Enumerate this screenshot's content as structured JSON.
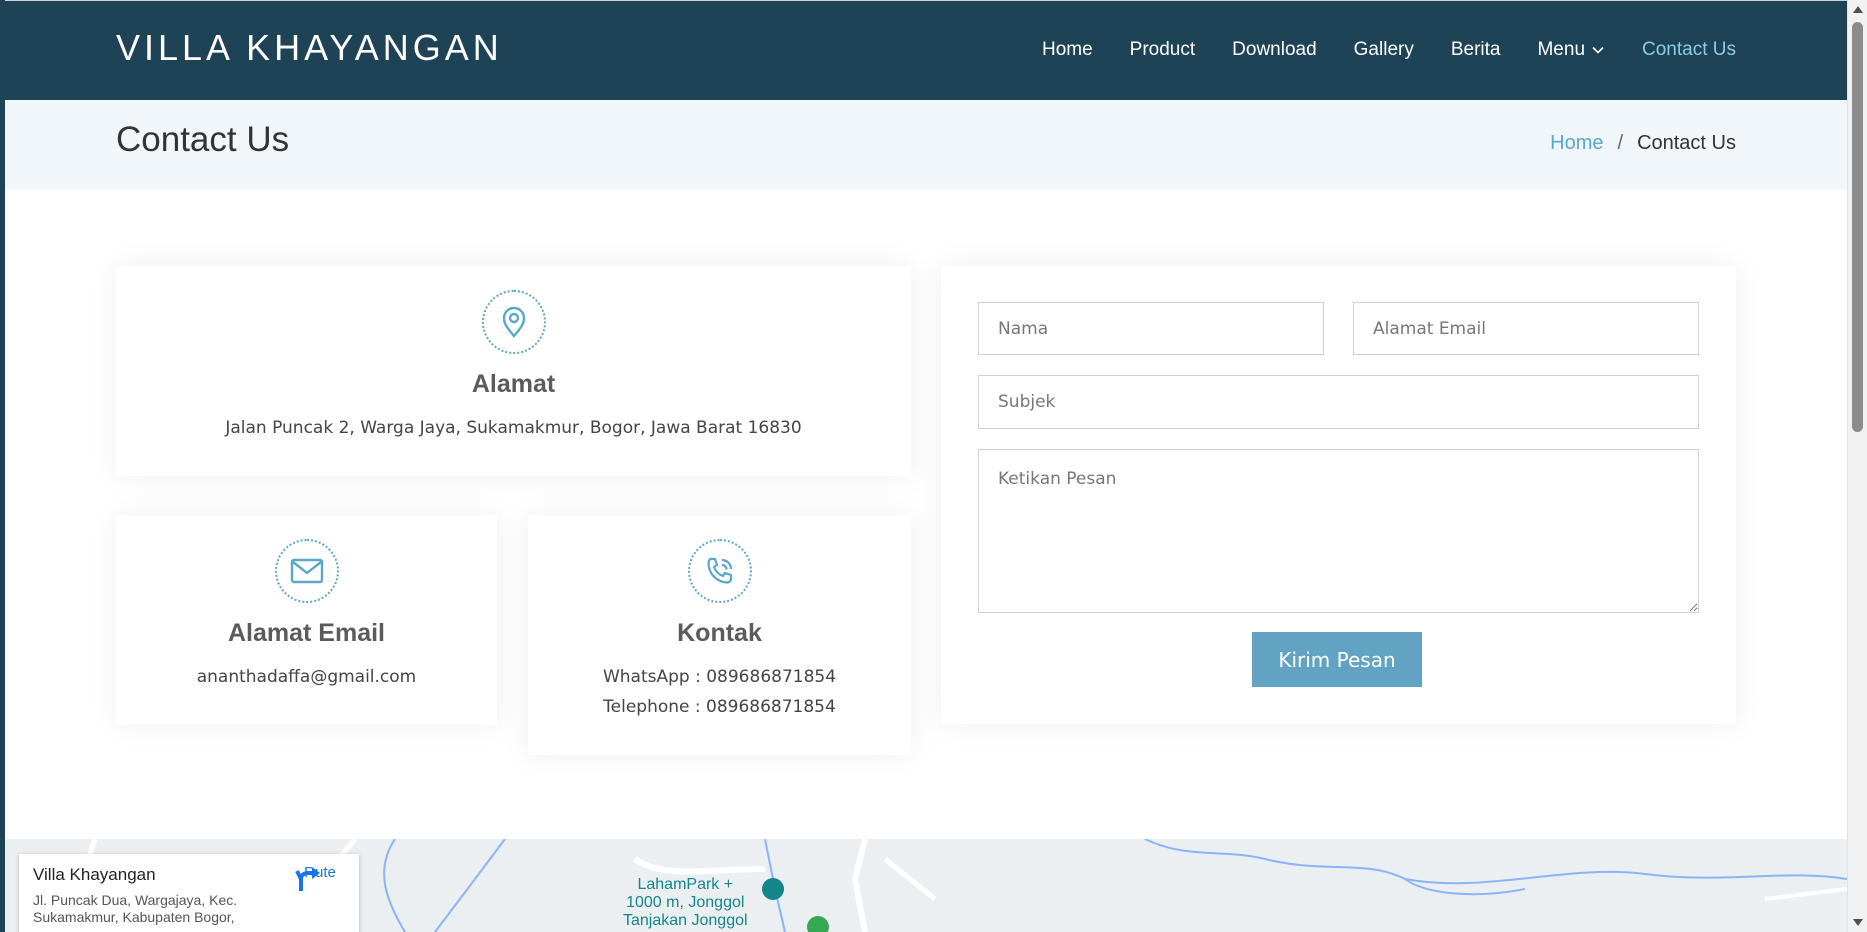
{
  "header": {
    "logo": "VILLA KHAYANGAN",
    "nav": [
      {
        "label": "Home"
      },
      {
        "label": "Product"
      },
      {
        "label": "Download"
      },
      {
        "label": "Gallery"
      },
      {
        "label": "Berita"
      },
      {
        "label": "Menu"
      },
      {
        "label": "Contact Us"
      }
    ],
    "active_color": "#8ccbe8",
    "bg_color": "#1e4356"
  },
  "breadcrumb": {
    "page_title": "Contact Us",
    "home": "Home",
    "separator": "/",
    "current": "Contact Us"
  },
  "cards": {
    "address": {
      "icon": "map-pin-icon",
      "title": "Alamat",
      "text": "Jalan Puncak 2, Warga Jaya, Sukamakmur, Bogor, Jawa Barat 16830"
    },
    "email": {
      "icon": "envelope-icon",
      "title": "Alamat Email",
      "text": "ananthadaffa@gmail.com"
    },
    "contact": {
      "icon": "phone-icon",
      "title": "Kontak",
      "whatsapp": "WhatsApp : 089686871854",
      "telephone": "Telephone : 089686871854"
    }
  },
  "form": {
    "name_placeholder": "Nama",
    "email_placeholder": "Alamat Email",
    "subject_placeholder": "Subjek",
    "message_placeholder": "Ketikan Pesan",
    "submit_label": "Kirim Pesan",
    "accent_color": "#62a3c4"
  },
  "map": {
    "place_name": "Villa Khayangan",
    "address": "Jl. Puncak Dua, Wargajaya, Kec. Sukamakmur, Kabupaten Bogor,",
    "route_label": "Rute",
    "poi_1": "LahamPark +",
    "poi_1b": "1000 m, Jonggol",
    "poi_2": "Tanjakan Jonggol"
  }
}
